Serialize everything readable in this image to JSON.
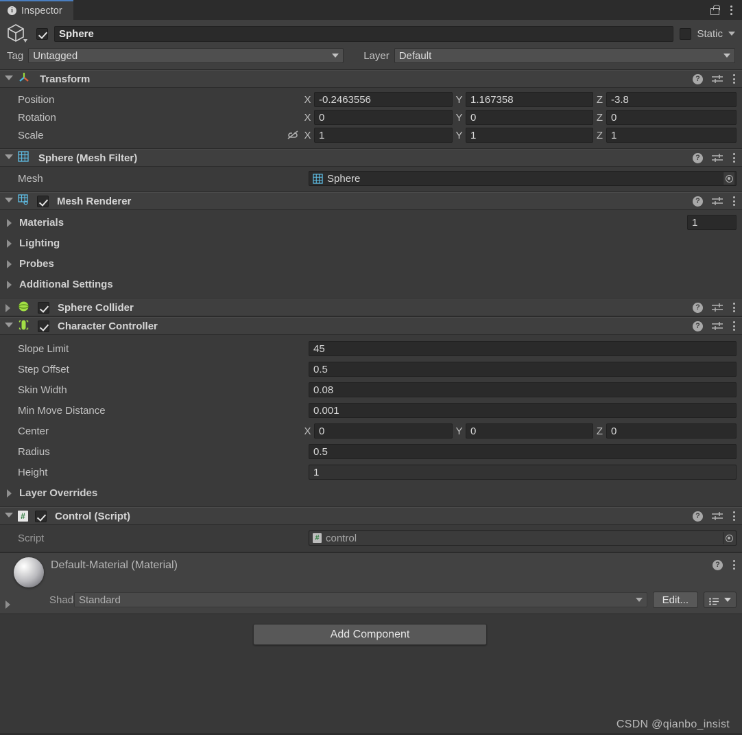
{
  "window": {
    "tab_label": "Inspector",
    "tab_icon": "info-icon",
    "lock_icon": "lock-open-icon",
    "menu_icon": "kebab-menu-icon"
  },
  "game_object": {
    "icon": "cube-icon",
    "enabled": true,
    "name": "Sphere",
    "static_label": "Static",
    "static_checked": false,
    "tag_label": "Tag",
    "tag_value": "Untagged",
    "layer_label": "Layer",
    "layer_value": "Default"
  },
  "components": [
    {
      "id": "transform",
      "title": "Transform",
      "icon": "transform-gizmo-icon",
      "expanded": true,
      "has_checkbox": false,
      "rows": [
        {
          "label": "Position",
          "type": "vector3",
          "x": "-0.2463556",
          "y": "1.167358",
          "z": "-3.8"
        },
        {
          "label": "Rotation",
          "type": "vector3",
          "x": "0",
          "y": "0",
          "z": "0"
        },
        {
          "label": "Scale",
          "type": "vector3",
          "x": "1",
          "y": "1",
          "z": "1",
          "link_icon": "scale-link-off-icon"
        }
      ]
    },
    {
      "id": "mesh-filter",
      "title": "Sphere (Mesh Filter)",
      "icon": "mesh-filter-icon",
      "expanded": true,
      "has_checkbox": false,
      "rows": [
        {
          "label": "Mesh",
          "type": "object",
          "value": "Sphere",
          "value_icon": "mesh-grid-icon"
        }
      ]
    },
    {
      "id": "mesh-renderer",
      "title": "Mesh Renderer",
      "icon": "mesh-renderer-icon",
      "expanded": true,
      "has_checkbox": true,
      "enabled": true,
      "foldouts": [
        {
          "label": "Materials",
          "expanded": false,
          "count": "1"
        },
        {
          "label": "Lighting",
          "expanded": false
        },
        {
          "label": "Probes",
          "expanded": false
        },
        {
          "label": "Additional Settings",
          "expanded": false
        }
      ]
    },
    {
      "id": "sphere-collider",
      "title": "Sphere Collider",
      "icon": "sphere-collider-icon",
      "expanded": false,
      "has_checkbox": true,
      "enabled": true
    },
    {
      "id": "character-controller",
      "title": "Character Controller",
      "icon": "character-controller-icon",
      "expanded": true,
      "has_checkbox": true,
      "enabled": true,
      "rows": [
        {
          "label": "Slope Limit",
          "type": "number",
          "value": "45"
        },
        {
          "label": "Step Offset",
          "type": "number",
          "value": "0.5"
        },
        {
          "label": "Skin Width",
          "type": "number",
          "value": "0.08"
        },
        {
          "label": "Min Move Distance",
          "type": "number",
          "value": "0.001"
        },
        {
          "label": "Center",
          "type": "vector3",
          "x": "0",
          "y": "0",
          "z": "0"
        },
        {
          "label": "Radius",
          "type": "number",
          "value": "0.5"
        },
        {
          "label": "Height",
          "type": "number",
          "value": "1",
          "focused": true
        }
      ],
      "foldouts": [
        {
          "label": "Layer Overrides",
          "expanded": false
        }
      ]
    },
    {
      "id": "control-script",
      "title": "Control (Script)",
      "icon": "csharp-script-icon",
      "expanded": true,
      "has_checkbox": true,
      "enabled": true,
      "rows": [
        {
          "label": "Script",
          "type": "object",
          "value": "control",
          "value_icon": "csharp-script-icon",
          "disabled": true
        }
      ]
    }
  ],
  "material": {
    "title": "Default-Material (Material)",
    "preview_icon": "material-sphere-preview",
    "shader_label": "Shader",
    "shader_value": "Standard",
    "edit_label": "Edit...",
    "help_icon": "help-icon",
    "menu_icon": "kebab-menu-icon",
    "preset_icon": "preset-list-icon",
    "expanded": false
  },
  "footer": {
    "add_component_label": "Add Component",
    "watermark": "CSDN @qianbo_insist"
  },
  "colors": {
    "panel_bg": "#383838",
    "header_bg": "#3f3f3f",
    "field_bg": "#2a2a2a",
    "accent_tab": "#4a7ec0",
    "icon_blue": "#5fc0e8",
    "icon_green": "#a2e045",
    "text": "#c4c4c4"
  }
}
